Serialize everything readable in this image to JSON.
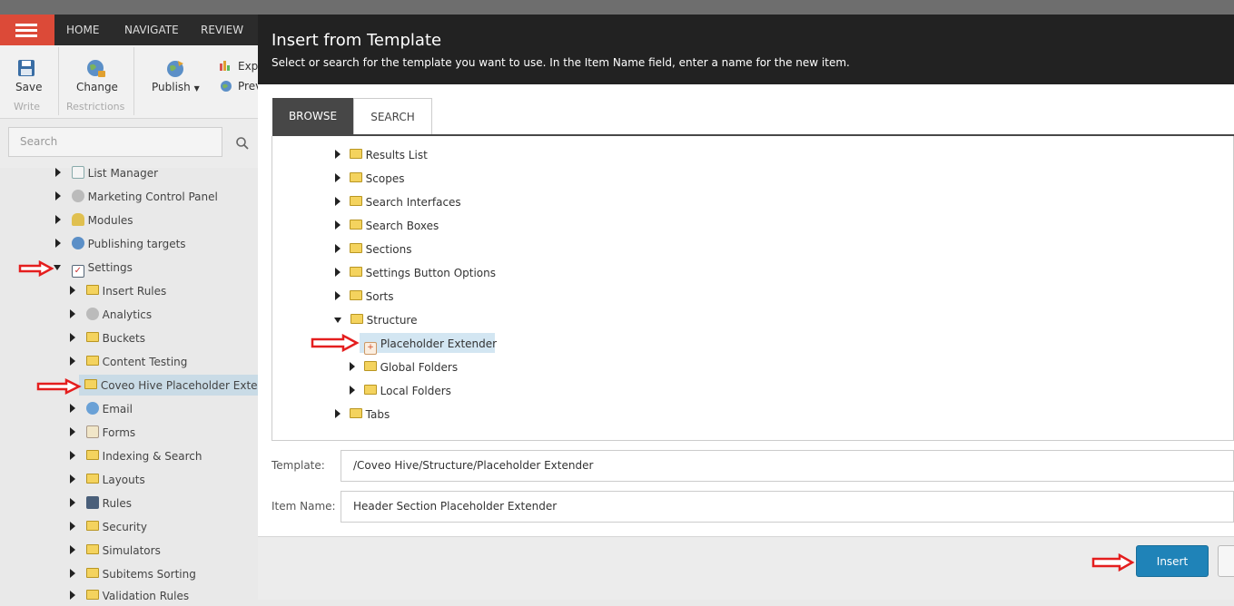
{
  "menubar": {
    "tabs": [
      "HOME",
      "NAVIGATE",
      "REVIEW"
    ]
  },
  "ribbon": {
    "save": "Save",
    "write_group": "Write",
    "change": "Change",
    "restrictions_group": "Restrictions",
    "publish": "Publish",
    "experience": "Exp",
    "preview": "Prev"
  },
  "left_search": {
    "placeholder": "Search"
  },
  "tree": [
    {
      "label": "List Manager",
      "icon": "list-icon",
      "expanded": false
    },
    {
      "label": "Marketing Control Panel",
      "icon": "analytics-icon",
      "expanded": false
    },
    {
      "label": "Modules",
      "icon": "modules-icon",
      "expanded": false
    },
    {
      "label": "Publishing targets",
      "icon": "publish-target-icon",
      "expanded": false
    },
    {
      "label": "Settings",
      "icon": "settings-icon",
      "expanded": true
    },
    {
      "label": "Insert Rules",
      "icon": "folder-icon",
      "expanded": false
    },
    {
      "label": "Analytics",
      "icon": "analytics-icon",
      "expanded": false
    },
    {
      "label": "Buckets",
      "icon": "folder-icon",
      "expanded": false
    },
    {
      "label": "Content Testing",
      "icon": "folder-icon",
      "expanded": false
    },
    {
      "label": "Coveo Hive Placeholder Extend",
      "icon": "folder-icon",
      "expanded": false,
      "selected": true
    },
    {
      "label": "Email",
      "icon": "email-icon",
      "expanded": false
    },
    {
      "label": "Forms",
      "icon": "forms-icon",
      "expanded": false
    },
    {
      "label": "Indexing & Search",
      "icon": "folder-icon",
      "expanded": false
    },
    {
      "label": "Layouts",
      "icon": "folder-icon",
      "expanded": false
    },
    {
      "label": "Rules",
      "icon": "rules-icon",
      "expanded": false
    },
    {
      "label": "Security",
      "icon": "folder-icon",
      "expanded": false
    },
    {
      "label": "Simulators",
      "icon": "folder-icon",
      "expanded": false
    },
    {
      "label": "Subitems Sorting",
      "icon": "folder-icon",
      "expanded": false
    },
    {
      "label": "Validation Rules",
      "icon": "folder-icon",
      "expanded": false
    }
  ],
  "dialog": {
    "title": "Insert from Template",
    "subtitle": "Select or search for the template you want to use. In the Item Name field, enter a name for the new item.",
    "tab_browse": "BROWSE",
    "tab_search": "SEARCH",
    "tree": [
      {
        "label": "Results List",
        "expanded": false
      },
      {
        "label": "Scopes",
        "expanded": false
      },
      {
        "label": "Search Interfaces",
        "expanded": false
      },
      {
        "label": "Search Boxes",
        "expanded": false
      },
      {
        "label": "Sections",
        "expanded": false
      },
      {
        "label": "Settings Button Options",
        "expanded": false
      },
      {
        "label": "Sorts",
        "expanded": false
      },
      {
        "label": "Structure",
        "expanded": true
      },
      {
        "label": "Placeholder Extender",
        "selected": true
      },
      {
        "label": "Global Folders",
        "expanded": false
      },
      {
        "label": "Local Folders",
        "expanded": false
      },
      {
        "label": "Tabs",
        "expanded": false
      }
    ],
    "template_label": "Template:",
    "template_value": "/Coveo Hive/Structure/Placeholder Extender",
    "item_name_label": "Item Name:",
    "item_name_value": "Header Section Placeholder Extender",
    "insert": "Insert"
  },
  "colors": {
    "accent_red": "#dc4a38",
    "insert_blue": "#1f83b8",
    "selected_bg": "#d3e6f2",
    "annotation_arrow": "#e41e1e"
  }
}
